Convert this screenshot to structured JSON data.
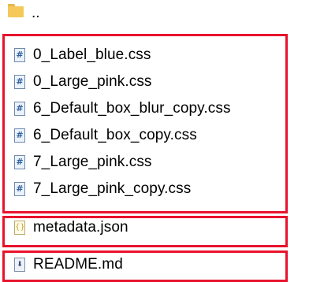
{
  "file_list": {
    "parent_folder": {
      "label": "..",
      "icon": "folder-icon"
    },
    "css_files": [
      {
        "name": "0_Label_blue.css",
        "icon": "css-file-icon"
      },
      {
        "name": "0_Large_pink.css",
        "icon": "css-file-icon"
      },
      {
        "name": "6_Default_box_blur_copy.css",
        "icon": "css-file-icon"
      },
      {
        "name": "6_Default_box_copy.css",
        "icon": "css-file-icon"
      },
      {
        "name": "7_Large_pink.css",
        "icon": "css-file-icon"
      },
      {
        "name": "7_Large_pink_copy.css",
        "icon": "css-file-icon"
      }
    ],
    "json_file": {
      "name": "metadata.json",
      "icon": "json-file-icon"
    },
    "md_file": {
      "name": "README.md",
      "icon": "markdown-file-icon"
    },
    "glyphs": {
      "css": "#",
      "json": "{}",
      "md": "⬇"
    }
  },
  "colors": {
    "highlight": "#e8132c",
    "folder": "#f5c85a",
    "css_glyph": "#2f5f9f"
  }
}
